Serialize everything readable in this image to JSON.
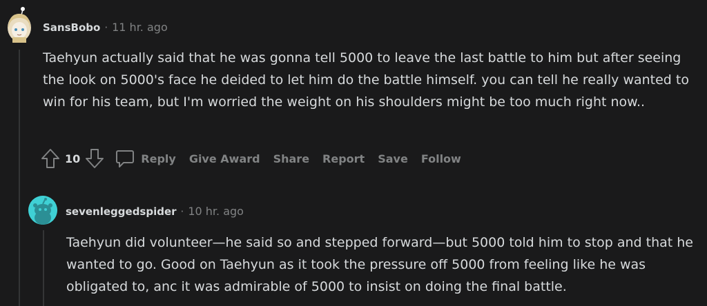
{
  "comment": {
    "username": "SansBobo",
    "separator": "·",
    "time": "11 hr. ago",
    "body": "Taehyun actually said that he was gonna tell 5000 to leave the last battle to him but after seeing the look on 5000's face he deided to let him do the battle himself. you can tell he really wanted to win for his team, but I'm worried the weight on his shoulders might be too much right now..",
    "score": "10",
    "actions": {
      "reply": "Reply",
      "give_award": "Give Award",
      "share": "Share",
      "report": "Report",
      "save": "Save",
      "follow": "Follow"
    }
  },
  "reply": {
    "username": "sevenleggedspider",
    "separator": "·",
    "time": "10 hr. ago",
    "body": "Taehyun did volunteer—he said so and stepped forward—but 5000 told him to stop and that he wanted to go. Good on Taehyun as it took the pressure off 5000 from feeling like he was obligated to, anc it was admirable of 5000 to insist on doing the final battle."
  },
  "colors": {
    "background": "#1a1a1b",
    "text": "#d7dadc",
    "muted": "#818384",
    "reply_avatar": "#3fd0d4"
  }
}
